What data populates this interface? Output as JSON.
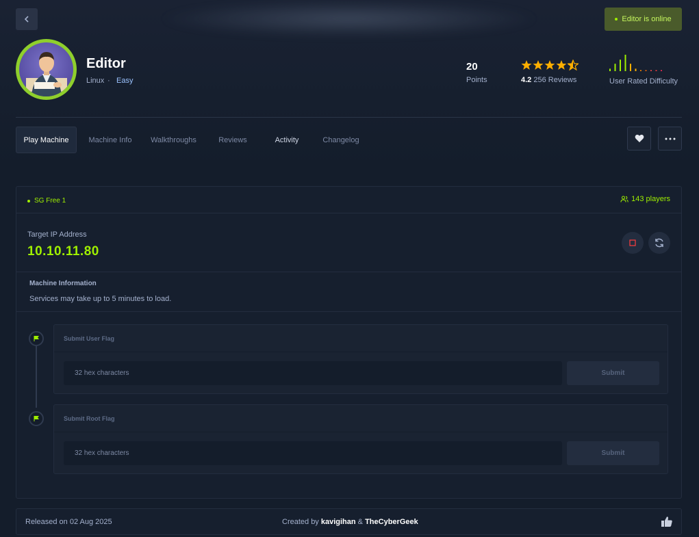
{
  "header": {
    "back_icon": "chevron-left-icon",
    "status_text": "Editor is online",
    "status_color": "#9fef00"
  },
  "machine": {
    "name": "Editor",
    "os": "Linux",
    "separator": "·",
    "difficulty": "Easy",
    "points_value": "20",
    "points_label": "Points",
    "rating_value": "4.2",
    "rating_stars": 4.5,
    "reviews_text": "256 Reviews",
    "difficulty_label": "User Rated Difficulty",
    "difficulty_bars": [
      0.15,
      0.45,
      0.7,
      1.0,
      0.45,
      0.15,
      0.05,
      0.05,
      0.05,
      0.05,
      0.05
    ]
  },
  "tabs": [
    {
      "label": "Play Machine",
      "active": true
    },
    {
      "label": "Machine Info",
      "active": false
    },
    {
      "label": "Walkthroughs",
      "active": false
    },
    {
      "label": "Reviews",
      "active": false
    },
    {
      "label": "Activity",
      "active": false
    },
    {
      "label": "Changelog",
      "active": false
    }
  ],
  "actions": {
    "favorite_icon": "heart-icon",
    "more_icon": "more-horizontal-icon"
  },
  "panel": {
    "server": "SG Free 1",
    "players": "143 players",
    "ip_label": "Target IP Address",
    "ip_value": "10.10.11.80",
    "stop_icon": "stop-icon",
    "reset_icon": "refresh-icon",
    "info_title": "Machine Information",
    "info_text": "Services may take up to 5 minutes to load."
  },
  "flags": [
    {
      "title": "Submit User Flag",
      "placeholder": "32 hex characters",
      "submit_label": "Submit"
    },
    {
      "title": "Submit Root Flag",
      "placeholder": "32 hex characters",
      "submit_label": "Submit"
    }
  ],
  "footer": {
    "released": "Released on 02 Aug 2025",
    "created_prefix": "Created by ",
    "creator_1": "kavigihan",
    "and": " & ",
    "creator_2": "TheCyberGeek",
    "like_icon": "thumbs-up-icon"
  }
}
